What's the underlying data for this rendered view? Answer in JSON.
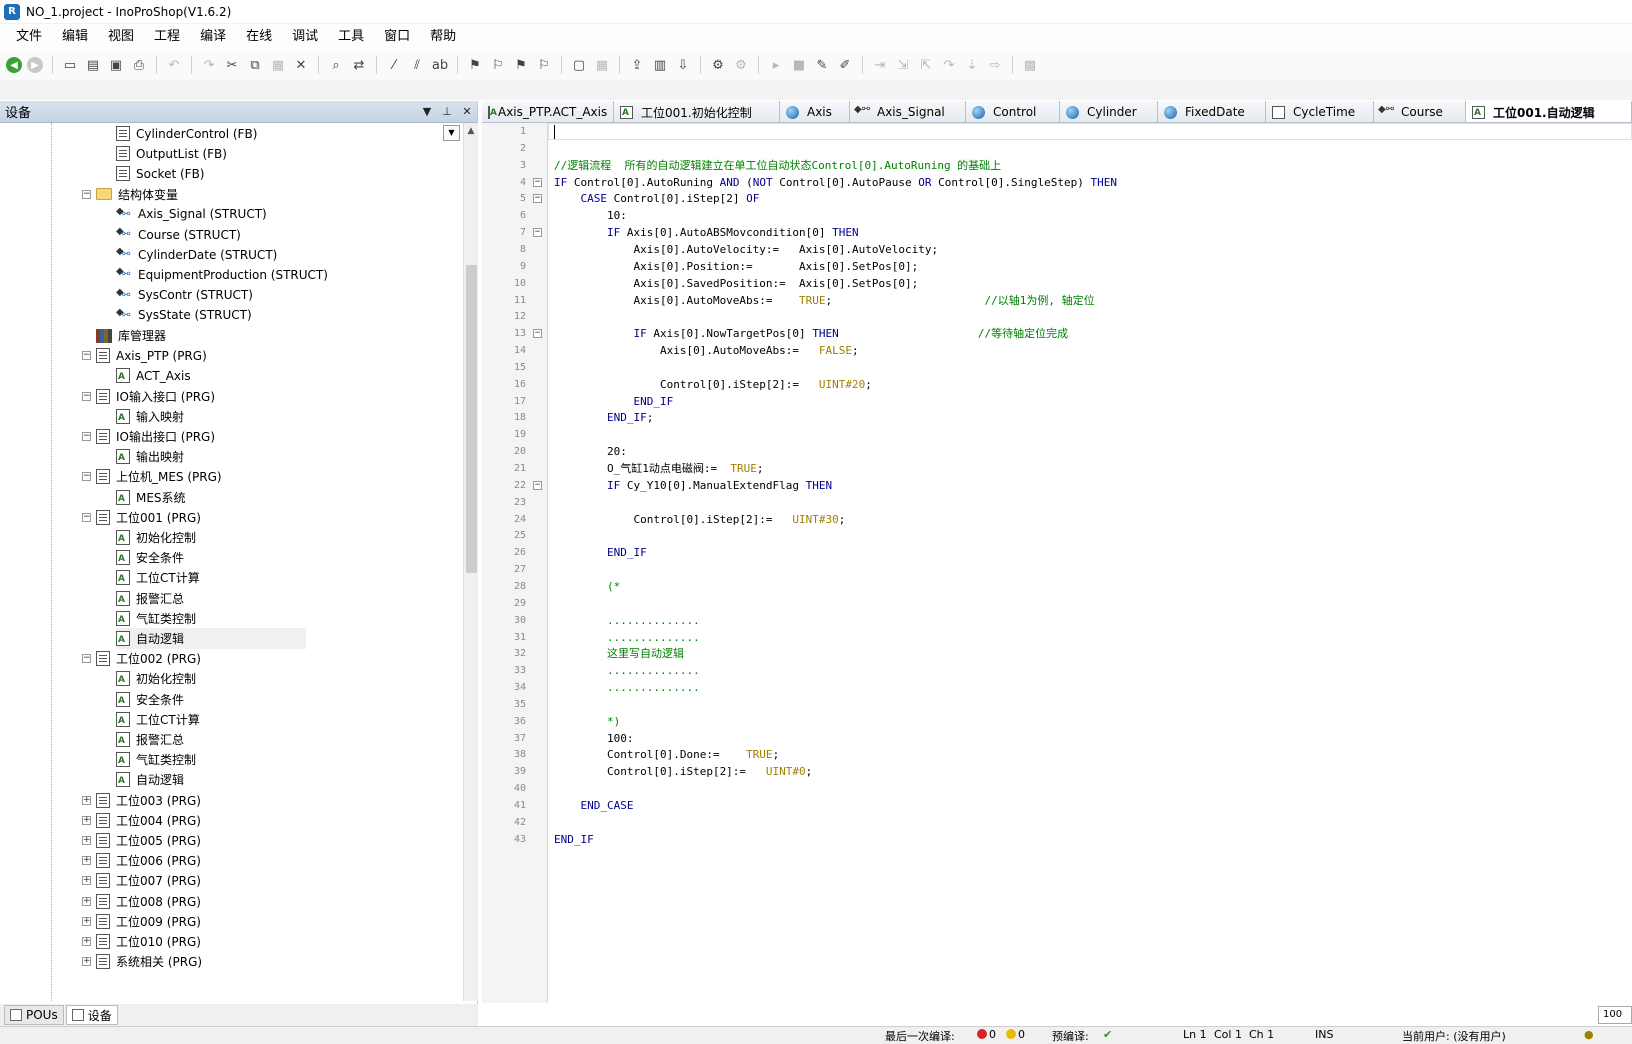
{
  "window": {
    "title": "NO_1.project - InoProShop(V1.6.2)",
    "logo": "R"
  },
  "menu": [
    "文件",
    "编辑",
    "视图",
    "工程",
    "编译",
    "在线",
    "调试",
    "工具",
    "窗口",
    "帮助"
  ],
  "toolbar_icons": [
    "back-icon",
    "forward-icon",
    "new-icon",
    "open-icon",
    "save-icon",
    "print-icon",
    "undo-icon",
    "redo-icon",
    "cut-icon",
    "copy-icon",
    "paste-icon",
    "delete-icon",
    "find-icon",
    "replace-icon",
    "comment-icon",
    "uncomment-icon",
    "rename-icon",
    "bookmark-icon",
    "bookmark-next-icon",
    "bookmark-prev-icon",
    "bookmark-clear-icon",
    "window-icon",
    "grid-icon",
    "export-icon",
    "build-icon",
    "download-icon",
    "login-icon",
    "logout-icon",
    "run-icon",
    "stop-icon",
    "settings-icon",
    "edit-icon",
    "step-icon",
    "step-into-icon",
    "step-out-icon",
    "step-over-icon",
    "breakpoint-icon",
    "next-icon",
    "monitor-icon"
  ],
  "left_panel": {
    "title": "设备",
    "tree": [
      {
        "label": "CylinderControl (FB)",
        "icon": "doc",
        "level": 2
      },
      {
        "label": "OutputList (FB)",
        "icon": "doc",
        "level": 2
      },
      {
        "label": "Socket (FB)",
        "icon": "doc",
        "level": 2
      },
      {
        "label": "结构体变量",
        "icon": "folder",
        "level": 1,
        "expander": "−"
      },
      {
        "label": "Axis_Signal (STRUCT)",
        "icon": "struct",
        "level": 2
      },
      {
        "label": "Course (STRUCT)",
        "icon": "struct",
        "level": 2
      },
      {
        "label": "CylinderDate (STRUCT)",
        "icon": "struct",
        "level": 2
      },
      {
        "label": "EquipmentProduction (STRUCT)",
        "icon": "struct",
        "level": 2
      },
      {
        "label": "SysContr (STRUCT)",
        "icon": "struct",
        "level": 2
      },
      {
        "label": "SysState (STRUCT)",
        "icon": "struct",
        "level": 2
      },
      {
        "label": "库管理器",
        "icon": "lib",
        "level": 1
      },
      {
        "label": "Axis_PTP (PRG)",
        "icon": "doc",
        "level": 1,
        "expander": "−"
      },
      {
        "label": "ACT_Axis",
        "icon": "act",
        "level": 2
      },
      {
        "label": "IO输入接口 (PRG)",
        "icon": "doc",
        "level": 1,
        "expander": "−"
      },
      {
        "label": "输入映射",
        "icon": "act",
        "level": 2
      },
      {
        "label": "IO输出接口 (PRG)",
        "icon": "doc",
        "level": 1,
        "expander": "−"
      },
      {
        "label": "输出映射",
        "icon": "act",
        "level": 2
      },
      {
        "label": "上位机_MES (PRG)",
        "icon": "doc",
        "level": 1,
        "expander": "−"
      },
      {
        "label": "MES系统",
        "icon": "act",
        "level": 2
      },
      {
        "label": "工位001 (PRG)",
        "icon": "doc",
        "level": 1,
        "expander": "−"
      },
      {
        "label": "初始化控制",
        "icon": "act",
        "level": 2
      },
      {
        "label": "安全条件",
        "icon": "act",
        "level": 2
      },
      {
        "label": "工位CT计算",
        "icon": "act",
        "level": 2
      },
      {
        "label": "报警汇总",
        "icon": "act",
        "level": 2
      },
      {
        "label": "气缸类控制",
        "icon": "act",
        "level": 2
      },
      {
        "label": "自动逻辑",
        "icon": "act",
        "level": 2,
        "selected": true
      },
      {
        "label": "工位002 (PRG)",
        "icon": "doc",
        "level": 1,
        "expander": "−"
      },
      {
        "label": "初始化控制",
        "icon": "act",
        "level": 2
      },
      {
        "label": "安全条件",
        "icon": "act",
        "level": 2
      },
      {
        "label": "工位CT计算",
        "icon": "act",
        "level": 2
      },
      {
        "label": "报警汇总",
        "icon": "act",
        "level": 2
      },
      {
        "label": "气缸类控制",
        "icon": "act",
        "level": 2
      },
      {
        "label": "自动逻辑",
        "icon": "act",
        "level": 2
      },
      {
        "label": "工位003 (PRG)",
        "icon": "doc",
        "level": 1,
        "expander": "+"
      },
      {
        "label": "工位004 (PRG)",
        "icon": "doc",
        "level": 1,
        "expander": "+"
      },
      {
        "label": "工位005 (PRG)",
        "icon": "doc",
        "level": 1,
        "expander": "+"
      },
      {
        "label": "工位006 (PRG)",
        "icon": "doc",
        "level": 1,
        "expander": "+"
      },
      {
        "label": "工位007 (PRG)",
        "icon": "doc",
        "level": 1,
        "expander": "+"
      },
      {
        "label": "工位008 (PRG)",
        "icon": "doc",
        "level": 1,
        "expander": "+"
      },
      {
        "label": "工位009 (PRG)",
        "icon": "doc",
        "level": 1,
        "expander": "+"
      },
      {
        "label": "工位010 (PRG)",
        "icon": "doc",
        "level": 1,
        "expander": "+"
      },
      {
        "label": "系统相关 (PRG)",
        "icon": "doc",
        "level": 1,
        "expander": "+"
      }
    ],
    "bottom_tabs": [
      {
        "label": "POUs",
        "active": false
      },
      {
        "label": "设备",
        "active": true
      }
    ]
  },
  "tabs": [
    {
      "label": "Axis_PTP.ACT_Axis",
      "icon": "act"
    },
    {
      "label": "工位001.初始化控制",
      "icon": "act"
    },
    {
      "label": "Axis",
      "icon": "globe"
    },
    {
      "label": "Axis_Signal",
      "icon": "struct"
    },
    {
      "label": "Control",
      "icon": "globe"
    },
    {
      "label": "Cylinder",
      "icon": "globe"
    },
    {
      "label": "FixedDate",
      "icon": "globe"
    },
    {
      "label": "CycleTime",
      "icon": "doc"
    },
    {
      "label": "Course",
      "icon": "struct"
    },
    {
      "label": "工位001.自动逻辑",
      "icon": "act",
      "active": true
    }
  ],
  "code_lines": [
    {
      "n": "1",
      "t": ""
    },
    {
      "n": "2",
      "t": ""
    },
    {
      "n": "3",
      "t": "//逻辑流程  所有的自动逻辑建立在单工位自动状态Control[0].AutoRuning 的基础上",
      "cls": "c"
    },
    {
      "n": "4",
      "t": "IF Control[0].AutoRuning AND (NOT Control[0].AutoPause OR Control[0].SingleStep) THEN",
      "fold": "−"
    },
    {
      "n": "5",
      "t": "    CASE Control[0].iStep[2] OF",
      "fold": "−"
    },
    {
      "n": "6",
      "t": "        10:"
    },
    {
      "n": "7",
      "t": "        IF Axis[0].AutoABSMovcondition[0] THEN",
      "fold": "−"
    },
    {
      "n": "8",
      "t": "            Axis[0].AutoVelocity:=   Axis[0].AutoVelocity;"
    },
    {
      "n": "9",
      "t": "            Axis[0].Position:=       Axis[0].SetPos[0];"
    },
    {
      "n": "10",
      "t": "            Axis[0].SavedPosition:=  Axis[0].SetPos[0];"
    },
    {
      "n": "11",
      "t": "            Axis[0].AutoMoveAbs:=    TRUE;                       //以轴1为例, 轴定位"
    },
    {
      "n": "12",
      "t": ""
    },
    {
      "n": "13",
      "t": "            IF Axis[0].NowTargetPos[0] THEN                     //等待轴定位完成",
      "fold": "−"
    },
    {
      "n": "14",
      "t": "                Axis[0].AutoMoveAbs:=   FALSE;"
    },
    {
      "n": "15",
      "t": ""
    },
    {
      "n": "16",
      "t": "                Control[0].iStep[2]:=   UINT#20;"
    },
    {
      "n": "17",
      "t": "            END_IF"
    },
    {
      "n": "18",
      "t": "        END_IF;"
    },
    {
      "n": "19",
      "t": ""
    },
    {
      "n": "20",
      "t": "        20:"
    },
    {
      "n": "21",
      "t": "        O_气缸1动点电磁阀:=  TRUE;"
    },
    {
      "n": "22",
      "t": "        IF Cy_Y10[0].ManualExtendFlag THEN",
      "fold": "−"
    },
    {
      "n": "23",
      "t": ""
    },
    {
      "n": "24",
      "t": "            Control[0].iStep[2]:=   UINT#30;"
    },
    {
      "n": "25",
      "t": ""
    },
    {
      "n": "26",
      "t": "        END_IF"
    },
    {
      "n": "27",
      "t": ""
    },
    {
      "n": "28",
      "t": "        (*",
      "cls": "c"
    },
    {
      "n": "29",
      "t": "",
      "cls": "c"
    },
    {
      "n": "30",
      "t": "        ..............",
      "cls": "c"
    },
    {
      "n": "31",
      "t": "        ..............",
      "cls": "c"
    },
    {
      "n": "32",
      "t": "        这里写自动逻辑",
      "cls": "c"
    },
    {
      "n": "33",
      "t": "        ..............",
      "cls": "c"
    },
    {
      "n": "34",
      "t": "        ..............",
      "cls": "c"
    },
    {
      "n": "35",
      "t": "",
      "cls": "c"
    },
    {
      "n": "36",
      "t": "        *)",
      "cls": "c"
    },
    {
      "n": "37",
      "t": "        100:"
    },
    {
      "n": "38",
      "t": "        Control[0].Done:=    TRUE;"
    },
    {
      "n": "39",
      "t": "        Control[0].iStep[2]:=   UINT#0;"
    },
    {
      "n": "40",
      "t": ""
    },
    {
      "n": "41",
      "t": "    END_CASE"
    },
    {
      "n": "42",
      "t": ""
    },
    {
      "n": "43",
      "t": "END_IF"
    }
  ],
  "zoom": "100 %",
  "status": {
    "last_compile_label": "最后一次编译:",
    "errors": "0",
    "warnings": "0",
    "precompile_label": "预编译:",
    "precompile_ok": "✔",
    "ln": "Ln 1",
    "col": "Col 1",
    "ch": "Ch 1",
    "mode": "INS",
    "user": "当前用户: (没有用户)"
  },
  "colors": {
    "keyword": "#00008b",
    "comment": "#008000",
    "literal": "#a08000",
    "header": "#c5d3e4"
  }
}
